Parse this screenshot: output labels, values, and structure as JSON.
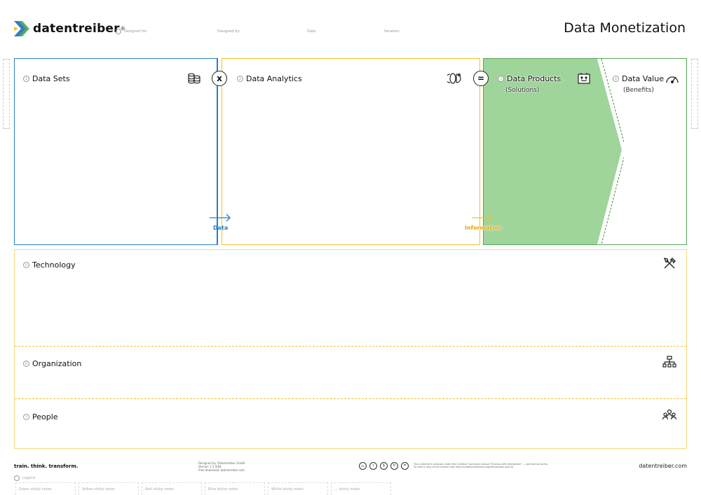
{
  "header": {
    "logo_text": "datentreiber",
    "logo_mark": "®",
    "meta_fields": [
      {
        "label": "Designed for:"
      },
      {
        "label": "Designed by:"
      },
      {
        "label": "Date:"
      },
      {
        "label": "Iteration:"
      }
    ],
    "title": "Data Monetization"
  },
  "sections": {
    "data_sets": {
      "num": "1",
      "label": "Data Sets"
    },
    "data_analytics": {
      "num": "2",
      "label": "Data Analytics"
    },
    "data_products": {
      "num": "3",
      "label": "Data Products",
      "sub": "(Solutions)"
    },
    "data_value": {
      "num": "4",
      "label": "Data Value",
      "sub": "(Benefits)"
    },
    "technology": {
      "num": "5",
      "label": "Technology"
    },
    "organization": {
      "num": "6",
      "label": "Organization"
    },
    "people": {
      "num": "7",
      "label": "People"
    }
  },
  "operators": {
    "multiply": "x",
    "equals": "="
  },
  "flows": {
    "data": "Data",
    "information": "Information"
  },
  "footer": {
    "tagline": "train. think. transform.",
    "credits": [
      "Designed by: Datentreiber GmbH",
      "Version 1.1 (EN)",
      "Free download: datentreiber.com"
    ],
    "license": [
      "This material is licensed under the Creative Commons license \"Sharing with Attribution\" — see license terms.",
      "To view a copy of the license visit http://creativecommons.org/licenses/by-sa/4.0/"
    ],
    "url": "datentreiber.com",
    "legend_label": "Legend",
    "legend_items": [
      "Green sticky notes",
      "Yellow sticky notes",
      "Red sticky notes",
      "Blue sticky notes",
      "White sticky notes",
      "... sticky notes"
    ]
  },
  "colors": {
    "blue": "#2a7fc1",
    "yellow": "#f2c12e",
    "green": "#5aa95a",
    "green_fill": "#9fd49b",
    "border_light": "#f5d77a"
  },
  "icons": [
    "coins-icon",
    "brain-icon",
    "product-icon",
    "speedometer-icon",
    "tools-icon",
    "org-chart-icon",
    "people-icon",
    "arrow-right-icon"
  ]
}
